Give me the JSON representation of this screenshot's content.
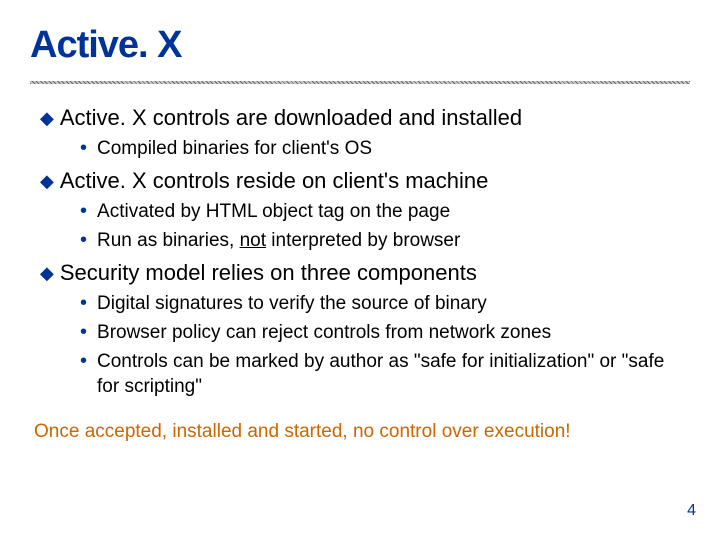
{
  "title": "Active. X",
  "bullets": [
    {
      "text": "Active. X controls are downloaded and installed",
      "subs": [
        "Compiled binaries for client's OS"
      ]
    },
    {
      "text": "Active. X controls reside on client's machine",
      "subs": [
        "Activated by HTML object tag on the page",
        "Run as binaries, {u}not{/u} interpreted by browser"
      ]
    },
    {
      "text": "Security model relies on three components",
      "subs": [
        "Digital signatures to verify the source of binary",
        "Browser policy can reject controls from network zones",
        "Controls can be marked by author as \"safe for initialization\" or \"safe for scripting\""
      ]
    }
  ],
  "footer": "Once accepted, installed and started, no control over execution!",
  "page_number": "4"
}
